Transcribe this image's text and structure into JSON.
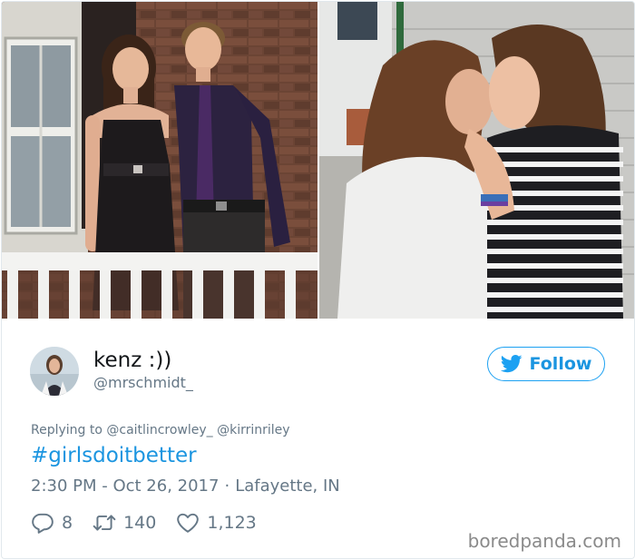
{
  "photos": {
    "left_photo": "photo-couple-on-porch",
    "right_photo": "photo-two-girls-kissing"
  },
  "user": {
    "display_name": "kenz :))",
    "handle": "@mrschmidt_"
  },
  "follow_button": {
    "label": "Follow",
    "icon": "twitter-bird-icon"
  },
  "tweet": {
    "replying_prefix": "Replying to",
    "mention_1": "@caitlincrowley_",
    "mention_2": "@kirrinriley",
    "hashtag": "#girlsdoitbetter",
    "time": "2:30 PM - Oct 26, 2017",
    "separator": "·",
    "location": "Lafayette, IN"
  },
  "actions": {
    "replies": "8",
    "retweets": "140",
    "likes": "1,123"
  },
  "watermark": "boredpanda.com",
  "colors": {
    "twitter_blue": "#1da1f2",
    "link_blue": "#1b95e0",
    "secondary_text": "#657786",
    "border": "#e1e8ed"
  }
}
